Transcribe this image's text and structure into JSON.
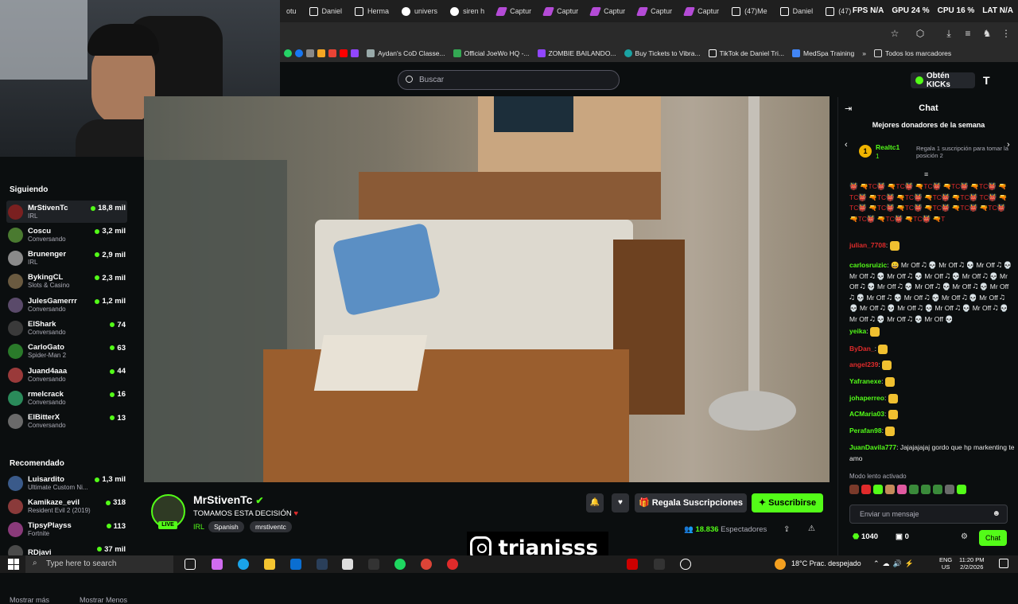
{
  "browser": {
    "tabs": [
      "otu",
      "Daniel",
      "Herma",
      "univers",
      "siren h",
      "Captur",
      "Captur",
      "Captur",
      "Captur",
      "Captur",
      "(47)Me",
      "Daniel",
      "(47)"
    ],
    "stats": [
      "FPS N/A",
      "GPU 24 %",
      "CPU 16 %",
      "LAT N/A"
    ],
    "bookmarks": [
      "Aydan's CoD Classe...",
      "Official JoeWo HQ -...",
      "ZOMBIE BAILANDO...",
      "Buy Tickets to Vibra...",
      "TikTok de Daniel Tri...",
      "MedSpa Training",
      "Todos los marcadores"
    ]
  },
  "header": {
    "search_placeholder": "Buscar",
    "kicks_label": "Obtén KICKs"
  },
  "sidebar": {
    "following_title": "Siguiendo",
    "following": [
      {
        "name": "MrStivenTc",
        "sub": "IRL",
        "viewers": "18,8 mil",
        "color": "#7a2020"
      },
      {
        "name": "Coscu",
        "sub": "Conversando",
        "viewers": "3,2 mil",
        "color": "#4a7a30"
      },
      {
        "name": "Brunenger",
        "sub": "IRL",
        "viewers": "2,9 mil",
        "color": "#8a8a8a"
      },
      {
        "name": "BykingCL",
        "sub": "Slots & Casino",
        "viewers": "2,3 mil",
        "color": "#6a5a40"
      },
      {
        "name": "JulesGamerrr",
        "sub": "Conversando",
        "viewers": "1,2 mil",
        "color": "#5a4a6a"
      },
      {
        "name": "ElShark",
        "sub": "Conversando",
        "viewers": "74",
        "color": "#3a3a3a"
      },
      {
        "name": "CarloGato",
        "sub": "Spider-Man 2",
        "viewers": "63",
        "color": "#2a7a2a"
      },
      {
        "name": "Juand4aaa",
        "sub": "Conversando",
        "viewers": "44",
        "color": "#9a3a3a"
      },
      {
        "name": "rmelcrack",
        "sub": "Conversando",
        "viewers": "16",
        "color": "#2a8a5a"
      },
      {
        "name": "ElBitterX",
        "sub": "Conversando",
        "viewers": "13",
        "color": "#6a6a6a"
      }
    ],
    "show_more": "Mostrar más",
    "show_less": "Mostrar Menos",
    "recommended_title": "Recomendado",
    "recommended": [
      {
        "name": "Luisardito",
        "sub": "Ultimate Custom Ni...",
        "viewers": "1,3 mil",
        "color": "#3a5a8a"
      },
      {
        "name": "Kamikaze_evil",
        "sub": "Resident Evil 2 (2019)",
        "viewers": "318",
        "color": "#8a3a3a"
      },
      {
        "name": "TipsyPlayss",
        "sub": "Fortnite",
        "viewers": "113",
        "color": "#8a3a7a"
      },
      {
        "name": "RDjavi",
        "sub": "",
        "viewers": "37 mil",
        "color": "#4a4a4a"
      }
    ]
  },
  "stream": {
    "channel": "MrStivenTc",
    "title": "TOMAMOS ESTA DECISIÓN",
    "category": "IRL",
    "tags": [
      "Spanish",
      "mrstiventc"
    ],
    "live_label": "LIVE",
    "gift_label": "Regala Suscripciones",
    "subscribe_label": "Suscribirse",
    "viewers_count": "18.836",
    "viewers_label": "Espectadores"
  },
  "chat": {
    "title": "Chat",
    "donors_title": "Mejores donadores de la semana",
    "top_donor": "Realtc1",
    "top_donor_count": "1",
    "donor_hint": "Regala 1 suscripción para tomar la posición 2",
    "spam_text": "👹 🔫TC👹 🔫TC👹 🔫TC👹 🔫TC👹 🔫TC👹 🔫TC👹 🔫TC👹 🔫TC👹 🔫TC👹 🔫TC👹 TC👹 🔫TC👹 🔫TC👹 🔫TC👹 🔫TC👹 🔫TC👹 🔫TC👹 🔫TC👹 🔫TC👹 🔫TC👹 🔫T",
    "messages": [
      {
        "user": "julian_7708",
        "color": "#e02b2b",
        "text": ""
      },
      {
        "user": "carlosruizic",
        "color": "#53fc18",
        "text": "😀 Mr Off 🎝 💀 Mr Off 🎝 💀 Mr Off 🎝 💀 Mr Off 🎝 💀 Mr Off 🎝 💀 Mr Off 🎝 💀 Mr Off 🎝 💀 Mr Off 🎝 💀 Mr Off 🎝 💀 Mr Off 🎝 💀 Mr Off 🎝 💀 Mr Off 🎝 💀 Mr Off 🎝 💀 Mr Off 🎝 💀 Mr Off 🎝 💀 Mr Off 🎝 💀 Mr Off 🎝 💀 Mr Off 🎝 💀 Mr Off 🎝 💀 Mr Off 🎝 💀 Mr Off 🎝 💀 Mr Off 🎝 💀 Mr Off 💀"
      },
      {
        "user": "yeika",
        "color": "#53fc18",
        "text": ""
      },
      {
        "user": "ByDan_",
        "color": "#e02b2b",
        "text": ""
      },
      {
        "user": "angel239",
        "color": "#e02b2b",
        "text": ""
      },
      {
        "user": "Yafranexe",
        "color": "#53fc18",
        "text": ""
      },
      {
        "user": "johaperreo",
        "color": "#53fc18",
        "text": ""
      },
      {
        "user": "ACMaria03",
        "color": "#53fc18",
        "text": ""
      },
      {
        "user": "Perafan98",
        "color": "#53fc18",
        "text": ""
      },
      {
        "user": "JuanDavila777",
        "color": "#53fc18",
        "text": "Jajajajajaj gordo que hp markenting te amo"
      }
    ],
    "slow_mode": "Modo lento activado",
    "input_placeholder": "Enviar un mensaje",
    "points": "1040",
    "gifts": "0",
    "send_label": "Chat"
  },
  "taskbar": {
    "search_placeholder": "Type here to search",
    "weather": "18°C  Prac. despejado",
    "lang": "ENG",
    "region": "US",
    "time": "11:20 PM",
    "date": "2/2/2026"
  },
  "watermark": "trianisss_"
}
